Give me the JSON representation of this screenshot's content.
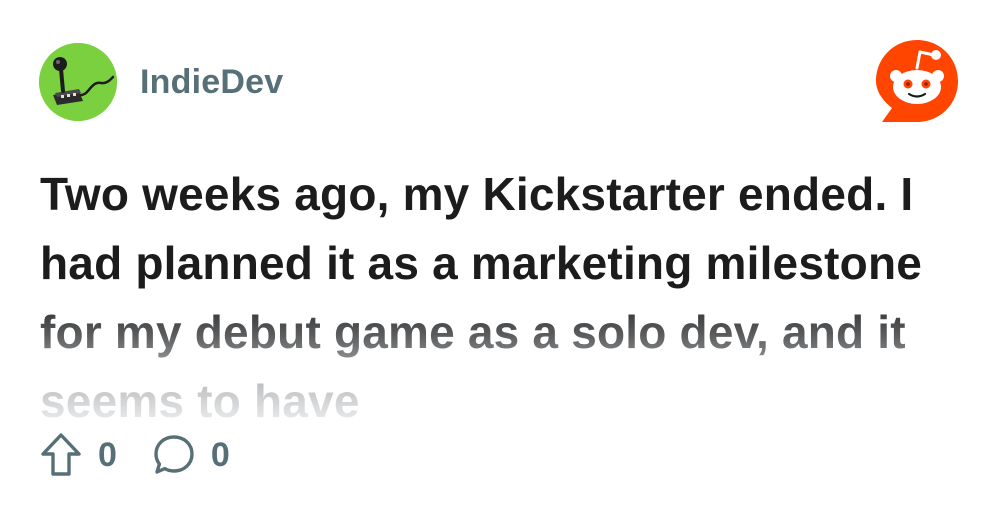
{
  "post": {
    "author": "IndieDev",
    "title": "Two weeks ago, my Kickstarter ended. I had planned it as a marketing milestone for my debut game as a solo dev, and it seems to have",
    "upvotes": "0",
    "comments": "0"
  },
  "icons": {
    "avatar": "joystick-avatar-icon",
    "brand": "reddit-logo-icon",
    "upvote": "upvote-arrow-icon",
    "comment": "comment-bubble-icon"
  },
  "colors": {
    "avatar_bg": "#7ad03f",
    "brand": "#ff4500",
    "meta_text": "#576f76",
    "title_text": "#1c1c1d"
  }
}
